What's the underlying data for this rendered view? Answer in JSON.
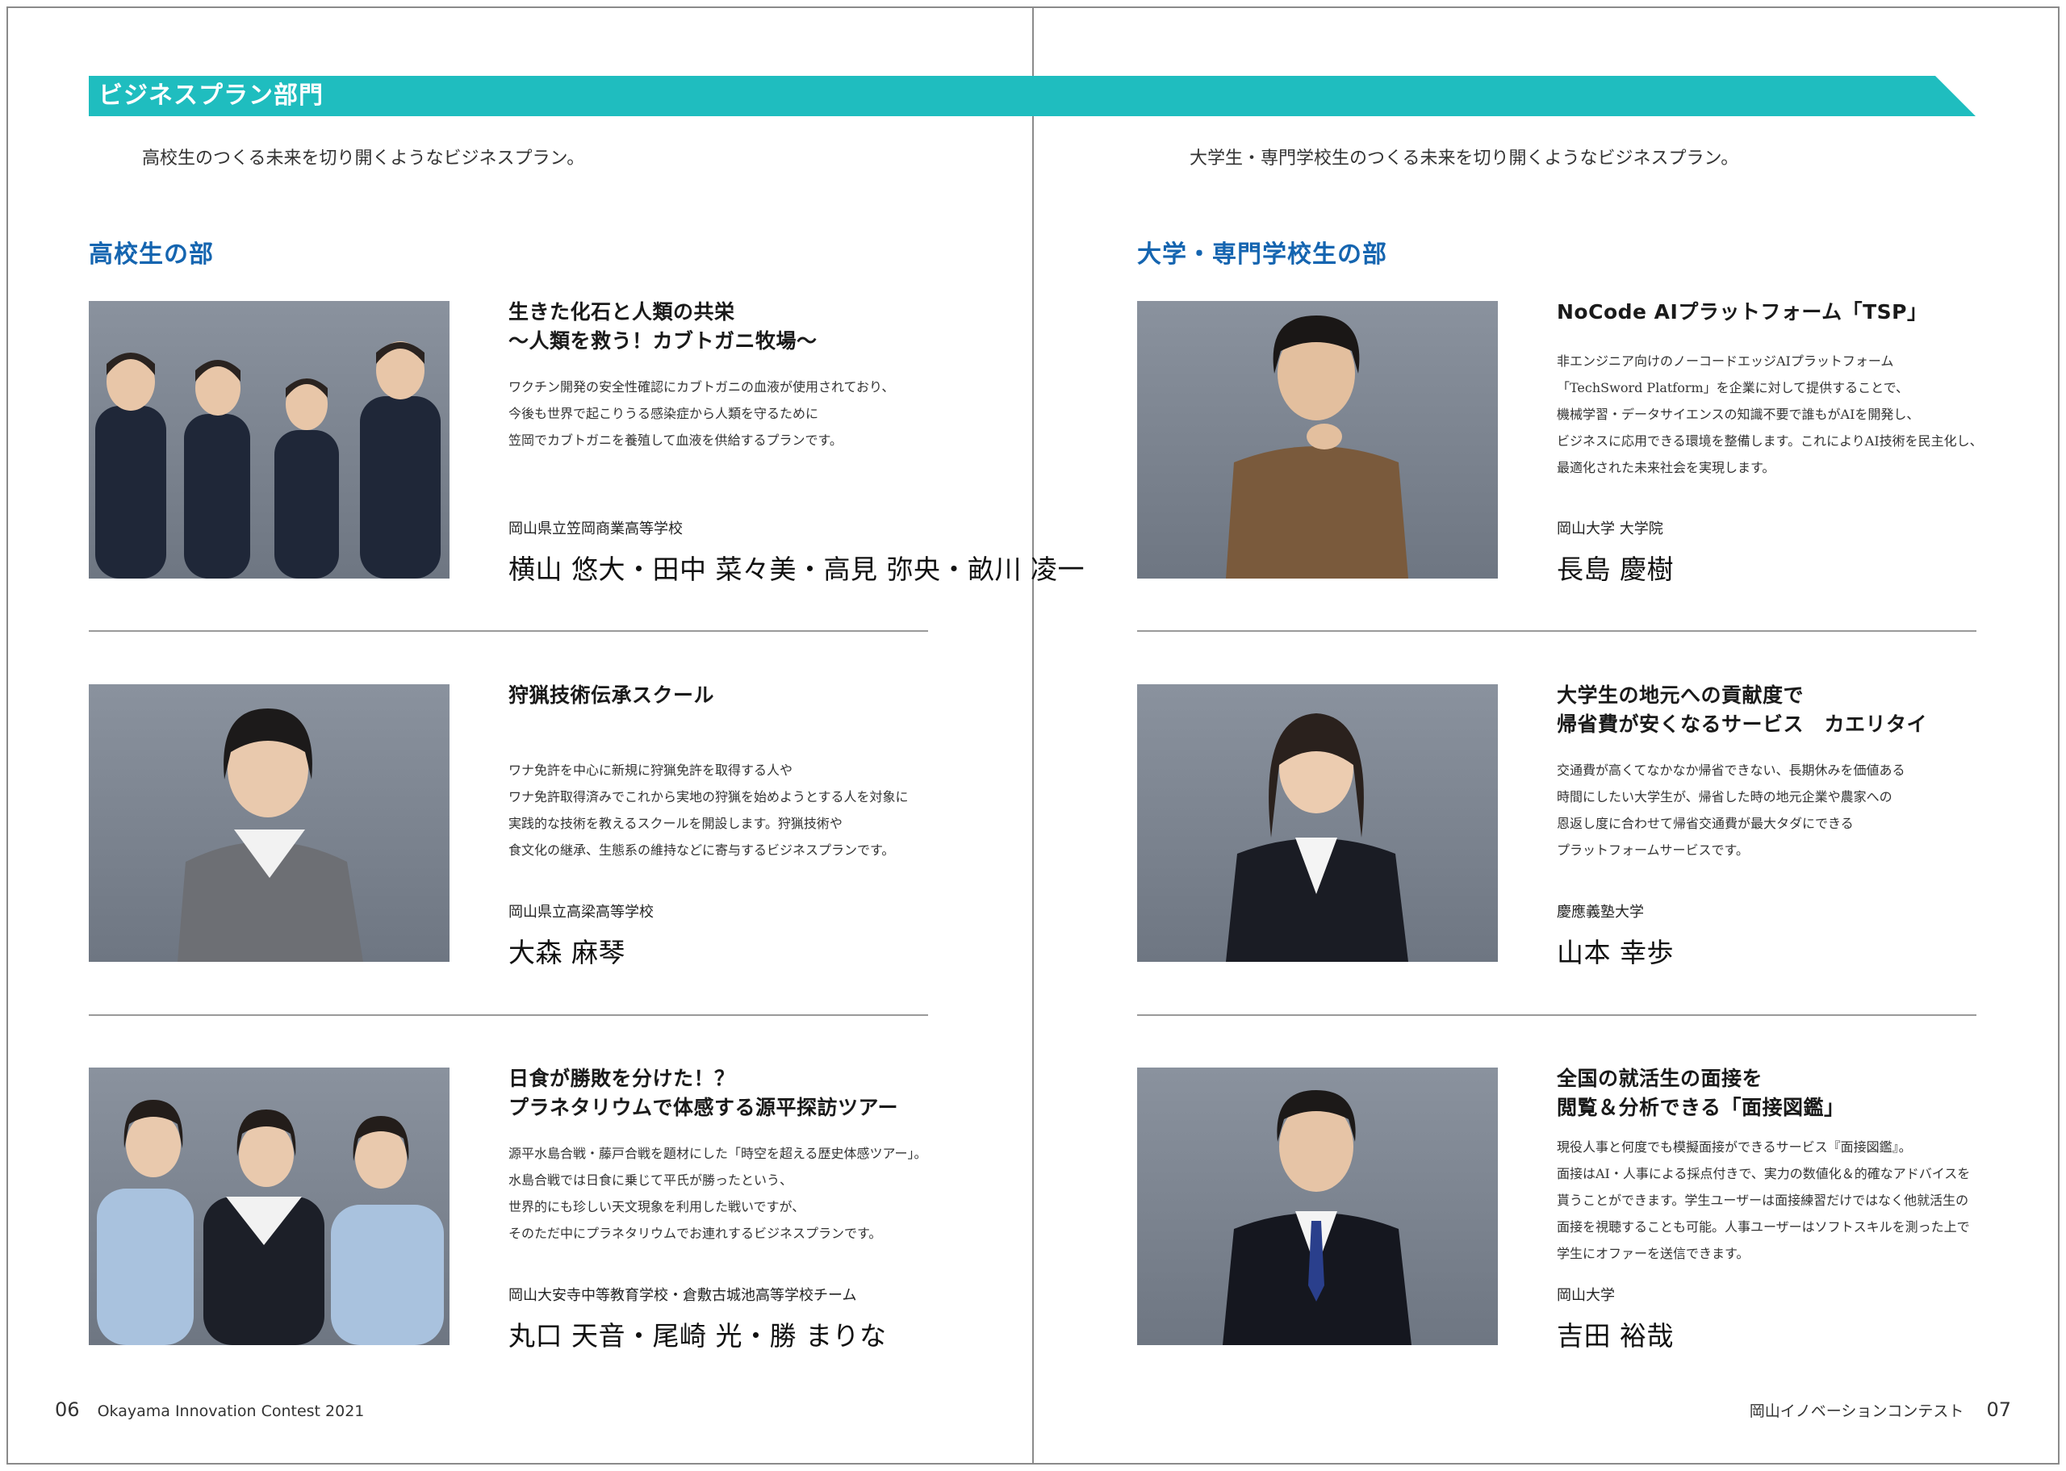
{
  "section": {
    "title": "ビジネスプラン部門"
  },
  "left": {
    "intro": "高校生のつくる未来を切り開くようなビジネスプラン。",
    "category": "高校生の部",
    "entries": [
      {
        "title": "生きた化石と人類の共栄\n〜人類を救う！カブトガニ牧場〜",
        "desc": "ワクチン開発の安全性確認にカブトガニの血液が使用されており、\n今後も世界で起こりうる感染症から人類を守るために\n笠岡でカブトガニを養殖して血液を供給するプランです。",
        "school": "岡山県立笠岡商業高等学校",
        "names": "横山 悠大・田中 菜々美・高見 弥央・畝川 凌一"
      },
      {
        "title": "狩猟技術伝承スクール",
        "desc": "ワナ免許を中心に新規に狩猟免許を取得する人や\nワナ免許取得済みでこれから実地の狩猟を始めようとする人を対象に\n実践的な技術を教えるスクールを開設します。狩猟技術や\n食文化の継承、生態系の維持などに寄与するビジネスプランです。",
        "school": "岡山県立高梁高等学校",
        "names": "大森 麻琴"
      },
      {
        "title": "日食が勝敗を分けた！？\nプラネタリウムで体感する源平探訪ツアー",
        "desc": "源平水島合戦・藤戸合戦を題材にした「時空を超える歴史体感ツアー」。\n水島合戦では日食に乗じて平氏が勝ったという、\n世界的にも珍しい天文現象を利用した戦いですが、\nそのただ中にプラネタリウムでお連れするビジネスプランです。",
        "school": "岡山大安寺中等教育学校・倉敷古城池高等学校チーム",
        "names": "丸口 天音・尾崎 光・勝 まりな"
      }
    ],
    "footer_page": "06",
    "footer_text": "Okayama Innovation Contest 2021"
  },
  "right": {
    "intro": "大学生・専門学校生のつくる未来を切り開くようなビジネスプラン。",
    "category": "大学・専門学校生の部",
    "entries": [
      {
        "title": "NoCode AIプラットフォーム「TSP」",
        "desc": "非エンジニア向けのノーコードエッジAIプラットフォーム\n「TechSword Platform」を企業に対して提供することで、\n機械学習・データサイエンスの知識不要で誰もがAIを開発し、\nビジネスに応用できる環境を整備します。これによりAI技術を民主化し、\n最適化された未来社会を実現します。",
        "school": "岡山大学 大学院",
        "names": "長島 慶樹"
      },
      {
        "title": "大学生の地元への貢献度で\n帰省費が安くなるサービス　カエリタイ",
        "desc": "交通費が高くてなかなか帰省できない、長期休みを価値ある\n時間にしたい大学生が、帰省した時の地元企業や農家への\n恩返し度に合わせて帰省交通費が最大タダにできる\nプラットフォームサービスです。",
        "school": "慶應義塾大学",
        "names": "山本 幸歩"
      },
      {
        "title": "全国の就活生の面接を\n閲覧＆分析できる「面接図鑑」",
        "desc": "現役人事と何度でも模擬面接ができるサービス『面接図鑑』。\n面接はAI・人事による採点付きで、実力の数値化＆的確なアドバイスを\n貰うことができます。学生ユーザーは面接練習だけではなく他就活生の\n面接を視聴することも可能。人事ユーザーはソフトスキルを測った上で\n学生にオファーを送信できます。",
        "school": "岡山大学",
        "names": "吉田 裕哉"
      }
    ],
    "footer_text": "岡山イノベーションコンテスト",
    "footer_page": "07"
  }
}
